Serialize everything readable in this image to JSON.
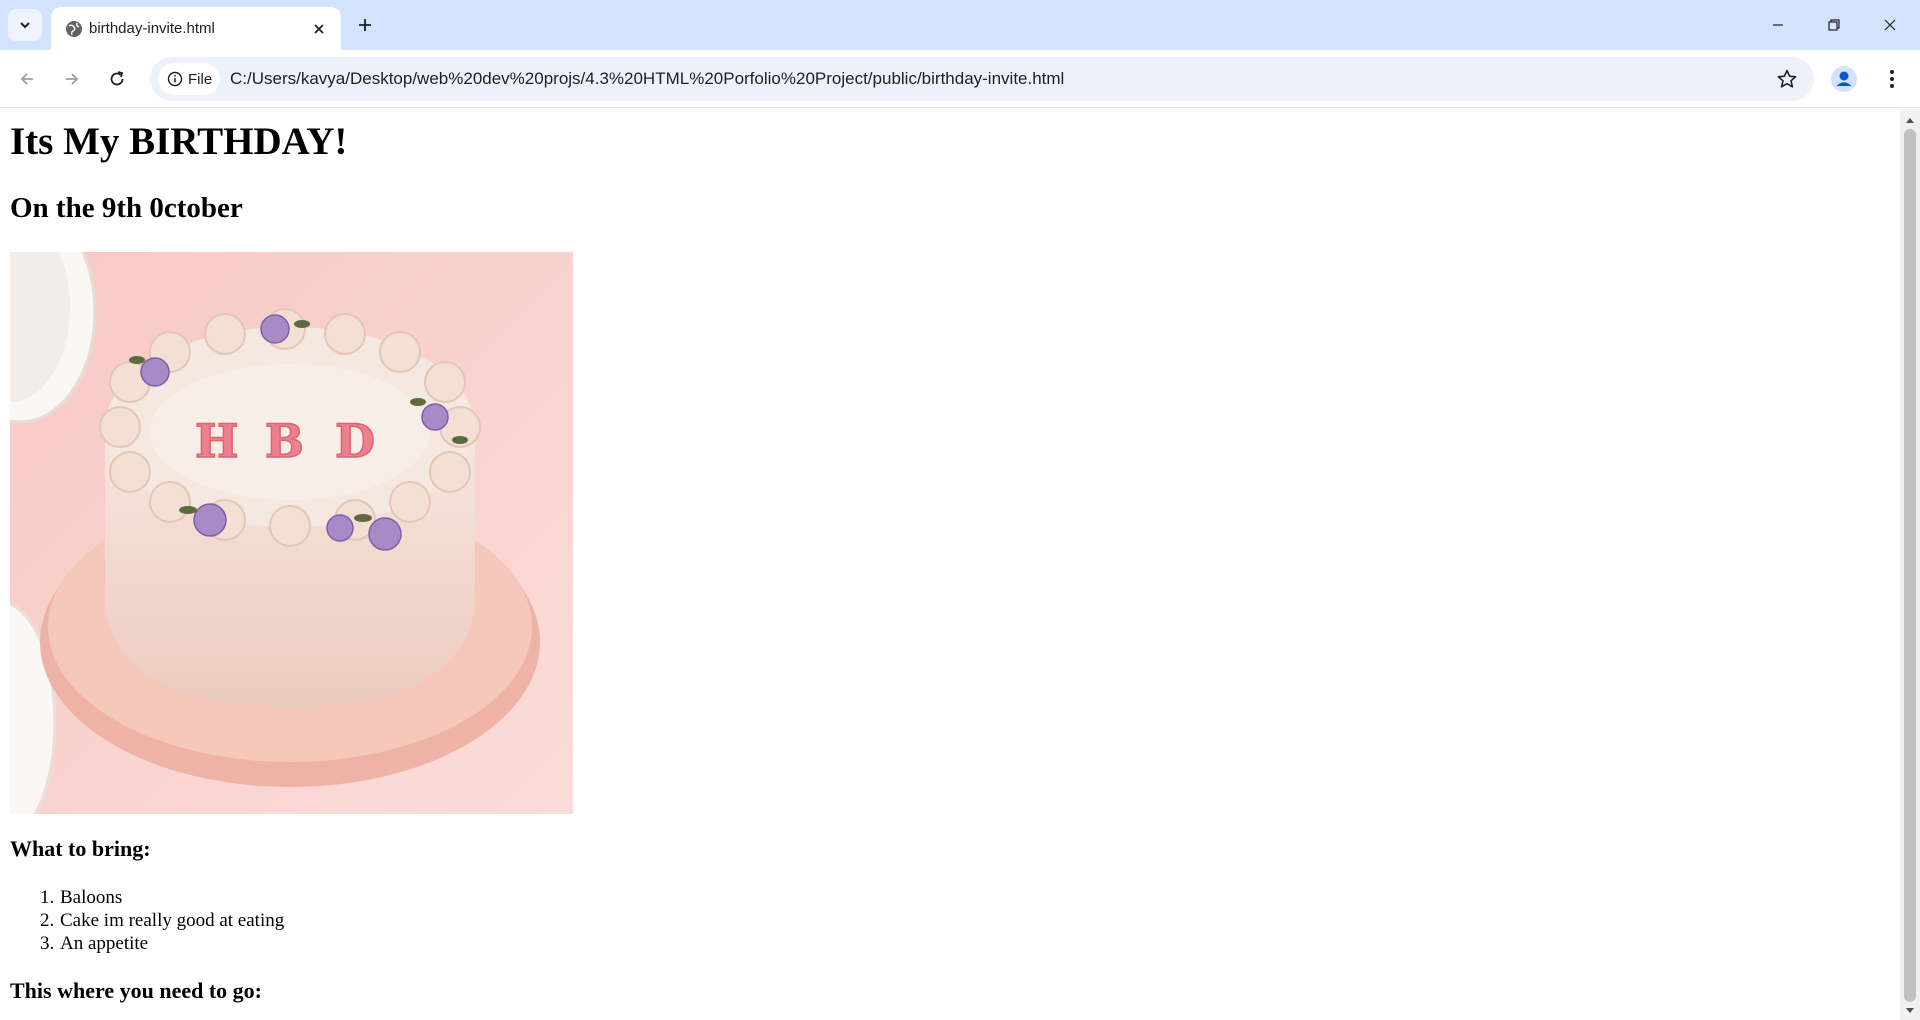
{
  "browser": {
    "tab": {
      "title": "birthday-invite.html",
      "favicon": "globe-icon"
    },
    "address": {
      "chip_label": "File",
      "url": "C:/Users/kavya/Desktop/web%20dev%20projs/4.3%20HTML%20Porfolio%20Project/public/birthday-invite.html"
    },
    "icons": {
      "tab_search": "chevron-down-icon",
      "new_tab": "plus-icon",
      "back": "arrow-left-icon",
      "forward": "arrow-right-icon",
      "reload": "reload-icon",
      "info": "info-icon",
      "bookmark": "star-icon",
      "profile": "profile-icon",
      "menu": "kebab-menu-icon"
    },
    "colors": {
      "tabstrip": "#d3e3fd",
      "omnibox": "#edf2fa",
      "profile": "#0b57d0"
    }
  },
  "page": {
    "heading": "Its My BIRTHDAY!",
    "subheading": "On the 9th 0ctober",
    "image": {
      "description": "cake-image",
      "letters": [
        "H",
        "B",
        "D"
      ]
    },
    "bring_heading": "What to bring:",
    "bring_items": [
      {
        "num": "1.",
        "text": "Baloons"
      },
      {
        "num": "2.",
        "text": "Cake im really good at eating"
      },
      {
        "num": "3.",
        "text": "An appetite"
      }
    ],
    "go_heading": "This where you need to go:"
  }
}
